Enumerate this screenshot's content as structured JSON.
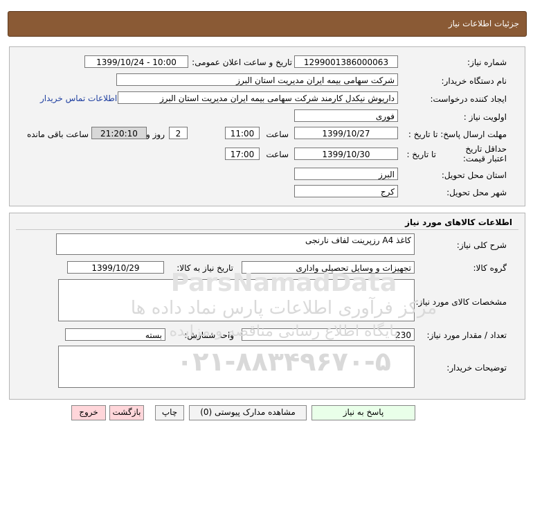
{
  "header": {
    "title": "جزئیات اطلاعات نیاز"
  },
  "info": {
    "need_number_label": "شماره نیاز:",
    "need_number": "1299001386000063",
    "announce_label": "تاریخ و ساعت اعلان عمومی:",
    "announce_value": "1399/10/24 - 10:00",
    "buyer_label": "نام دستگاه خریدار:",
    "buyer_value": "شرکت سهامی بیمه ایران مدیریت استان البرز",
    "creator_label": "ایجاد کننده درخواست:",
    "creator_value": "داریوش  نیکدل کارمند  شرکت سهامی بیمه ایران مدیریت استان البرز",
    "contact_link": "اطلاعات تماس خریدار",
    "priority_label": "اولویت نیاز :",
    "priority_value": "فوری",
    "send_deadline_label": "مهلت ارسال پاسخ: تا تاریخ :",
    "send_date": "1399/10/27",
    "time_label": "ساعت",
    "send_time": "11:00",
    "days_value": "2",
    "days_and_label": "روز و",
    "remaining_time": "21:20:10",
    "remaining_label": "ساعت باقی مانده",
    "price_validity_label": "حداقل تاریخ اعتبار قیمت:",
    "price_until_label": "تا تاریخ :",
    "price_date": "1399/10/30",
    "price_time_label": "ساعت",
    "price_time": "17:00",
    "province_label": "استان محل تحویل:",
    "province_value": "البرز",
    "city_label": "شهر محل تحویل:",
    "city_value": "کرج"
  },
  "goods": {
    "section_title": "اطلاعات کالاهای مورد نیاز",
    "desc_label": "شرح کلی نیاز:",
    "desc_value": "کاغذ A4 رزپرینت لفاف نارنجی",
    "group_label": "گروه کالا:",
    "group_value": "تجهیزات و وسایل تحصیلی واداری",
    "need_date_label": "تاریخ نیاز به کالا:",
    "need_date": "1399/10/29",
    "spec_label": "مشخصات کالای مورد نیاز:",
    "spec_value": "",
    "qty_label": "تعداد / مقدار مورد نیاز:",
    "qty_value": "230",
    "unit_label": "واحد شمارش:",
    "unit_value": "بسته",
    "buyer_notes_label": "توضیحات خریدار:",
    "buyer_notes_value": ""
  },
  "actions": {
    "reply": "پاسخ به نیاز",
    "attachments": "مشاهده مدارک پیوستی (0)",
    "print": "چاپ",
    "back": "بازگشت",
    "exit": "خروج"
  },
  "watermark": {
    "brand": "ParsNamadData",
    "line1": "مرکز فرآوری اطلاعات پارس نماد داده ها",
    "line2": "پایگاه اطلاع رسانی مناقصه و مزایده",
    "phone": "۰۲۱-۸۸۳۴۹۶۷۰-۵"
  },
  "colors": {
    "header": "#8a5a35",
    "panel": "#f3f3f3",
    "link": "#1f3fa0",
    "reply_button": "#e9ffe9",
    "exit_button": "#ffd6da"
  }
}
